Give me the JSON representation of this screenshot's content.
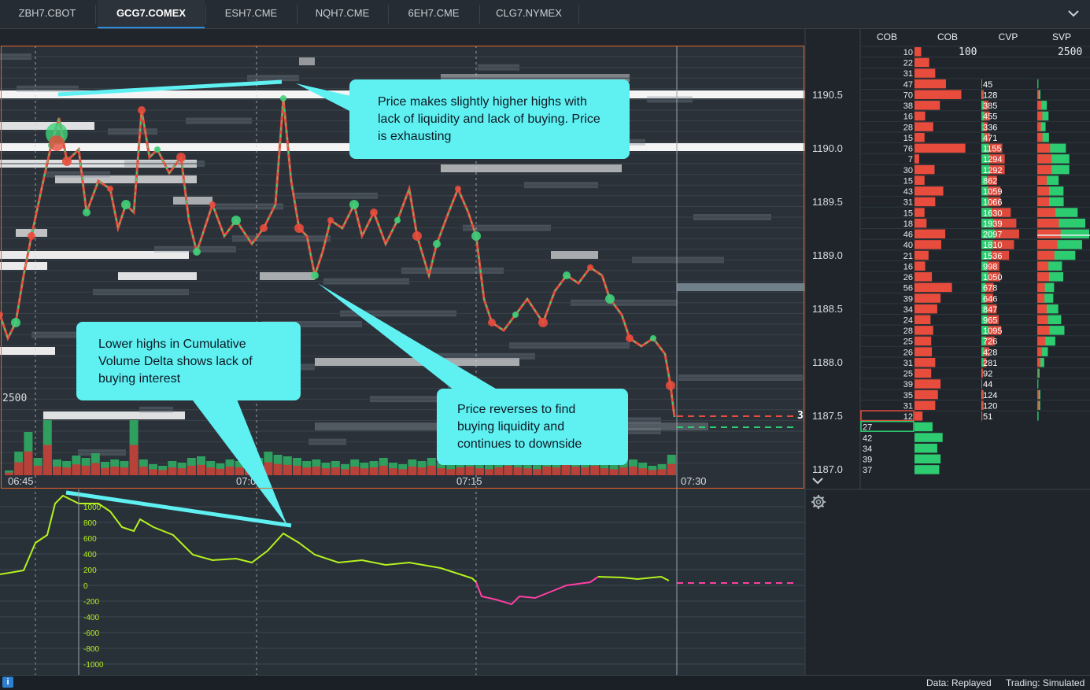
{
  "tabs": [
    {
      "label": "ZBH7.CBOT",
      "active": false
    },
    {
      "label": "GCG7.COMEX",
      "active": true
    },
    {
      "label": "ESH7.CME",
      "active": false
    },
    {
      "label": "NQH7.CME",
      "active": false
    },
    {
      "label": "6EH7.CME",
      "active": false
    },
    {
      "label": "CLG7.NYMEX",
      "active": false
    }
  ],
  "ladder_headers": [
    "COB",
    "COB",
    "CVP",
    "SVP"
  ],
  "cob_scale_label": "100",
  "svp_scale_label": "2500",
  "volume_scale_label": "2500",
  "last_price_marker": "3",
  "price_labels": [
    "1190.5",
    "1190.0",
    "1189.5",
    "1189.0",
    "1188.5",
    "1188.0",
    "1187.5",
    "1187.0"
  ],
  "time_labels": [
    "06:45",
    "07:00",
    "07:15",
    "07:30"
  ],
  "cvd_labels": [
    "1000",
    "800",
    "600",
    "400",
    "200",
    "0",
    "-200",
    "-400",
    "-600",
    "-800",
    "-1000"
  ],
  "ladder": {
    "ask_sizes": [
      10,
      22,
      31,
      47,
      70,
      38,
      16,
      28,
      15,
      76,
      7,
      30,
      15,
      43,
      31,
      15,
      18,
      46,
      40,
      21,
      16,
      26,
      56,
      39,
      34,
      24,
      28,
      25,
      26,
      31,
      25,
      39,
      35,
      31,
      12
    ],
    "bid_sizes": [
      27,
      42,
      34,
      39,
      37
    ],
    "cvp": [
      45,
      128,
      385,
      455,
      336,
      471,
      1155,
      1294,
      1292,
      862,
      1059,
      1066,
      1630,
      1939,
      2097,
      1810,
      1536,
      998,
      1050,
      678,
      646,
      847,
      965,
      1095,
      726,
      428,
      281,
      92,
      44,
      124,
      120,
      51
    ]
  },
  "callouts": {
    "top": "Price makes slightly higher highs with lack of liquidity and lack of buying. Price is exhausting",
    "left": "Lower highs in Cumulative Volume Delta shows lack of buying interest",
    "right": "Price reverses to find buying liquidity and continues to downside"
  },
  "status": {
    "data": "Data: Replayed",
    "trading": "Trading: Simulated"
  },
  "colors": {
    "accent": "#2e8bd8",
    "ask": "#e84c3d",
    "bid": "#2ecc71",
    "cvd_positive": "#b5f21d",
    "cvd_negative": "#ff3fa4",
    "callout": "#5ff0f2",
    "frame": "#e8642c"
  }
}
